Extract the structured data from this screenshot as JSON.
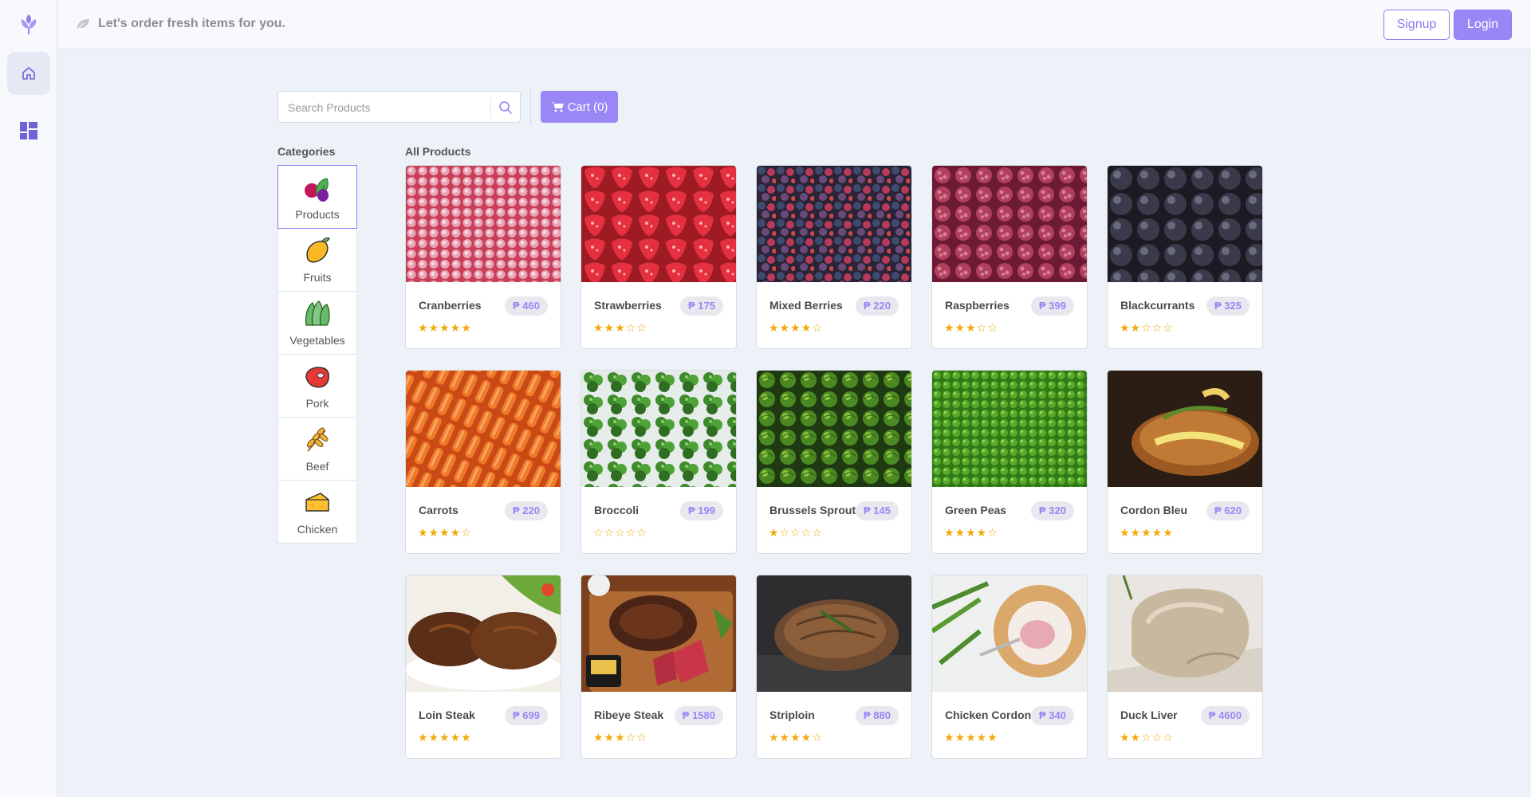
{
  "header": {
    "tagline": "Let's order fresh items for you.",
    "signup_label": "Signup",
    "login_label": "Login"
  },
  "search": {
    "placeholder": "Search Products",
    "value": ""
  },
  "cart": {
    "label": "Cart (0)"
  },
  "categories": {
    "heading": "Categories",
    "items": [
      {
        "label": "Products",
        "icon": "produce-icon",
        "active": true
      },
      {
        "label": "Fruits",
        "icon": "mango-icon"
      },
      {
        "label": "Vegetables",
        "icon": "lettuce-icon"
      },
      {
        "label": "Pork",
        "icon": "steak-icon"
      },
      {
        "label": "Beef",
        "icon": "wheat-icon"
      },
      {
        "label": "Chicken",
        "icon": "cheese-icon"
      }
    ]
  },
  "products": {
    "heading": "All Products",
    "currency": "₱",
    "items": [
      {
        "name": "Cranberries",
        "price": "₱ 460",
        "rating": 5,
        "stars": "★★★★★"
      },
      {
        "name": "Strawberries",
        "price": "₱ 175",
        "rating": 3,
        "stars": "★★★☆☆"
      },
      {
        "name": "Mixed Berries",
        "price": "₱ 220",
        "rating": 4,
        "stars": "★★★★☆"
      },
      {
        "name": "Raspberries",
        "price": "₱ 399",
        "rating": 3,
        "stars": "★★★☆☆"
      },
      {
        "name": "Blackcurrants",
        "price": "₱ 325",
        "rating": 2,
        "stars": "★★☆☆☆"
      },
      {
        "name": "Carrots",
        "price": "₱ 220",
        "rating": 4,
        "stars": "★★★★☆"
      },
      {
        "name": "Broccoli",
        "price": "₱ 199",
        "rating": 0,
        "stars": "☆☆☆☆☆"
      },
      {
        "name": "Brussels Sprouts",
        "price": "₱ 145",
        "rating": 1,
        "stars": "★☆☆☆☆"
      },
      {
        "name": "Green Peas",
        "price": "₱ 320",
        "rating": 4,
        "stars": "★★★★☆"
      },
      {
        "name": "Cordon Bleu",
        "price": "₱ 620",
        "rating": 5,
        "stars": "★★★★★"
      },
      {
        "name": "Loin Steak",
        "price": "₱ 699",
        "rating": 5,
        "stars": "★★★★★"
      },
      {
        "name": "Ribeye Steak",
        "price": "₱ 1580",
        "rating": 3,
        "stars": "★★★☆☆"
      },
      {
        "name": "Striploin",
        "price": "₱ 880",
        "rating": 4,
        "stars": "★★★★☆"
      },
      {
        "name": "Chicken Cordon",
        "price": "₱ 340",
        "rating": 5,
        "stars": "★★★★★"
      },
      {
        "name": "Duck Liver",
        "price": "₱ 4600",
        "rating": 2,
        "stars": "★★☆☆☆"
      }
    ]
  },
  "colors": {
    "accent": "#9a86f5",
    "star": "#f2a90a",
    "background": "#edf1f8"
  }
}
